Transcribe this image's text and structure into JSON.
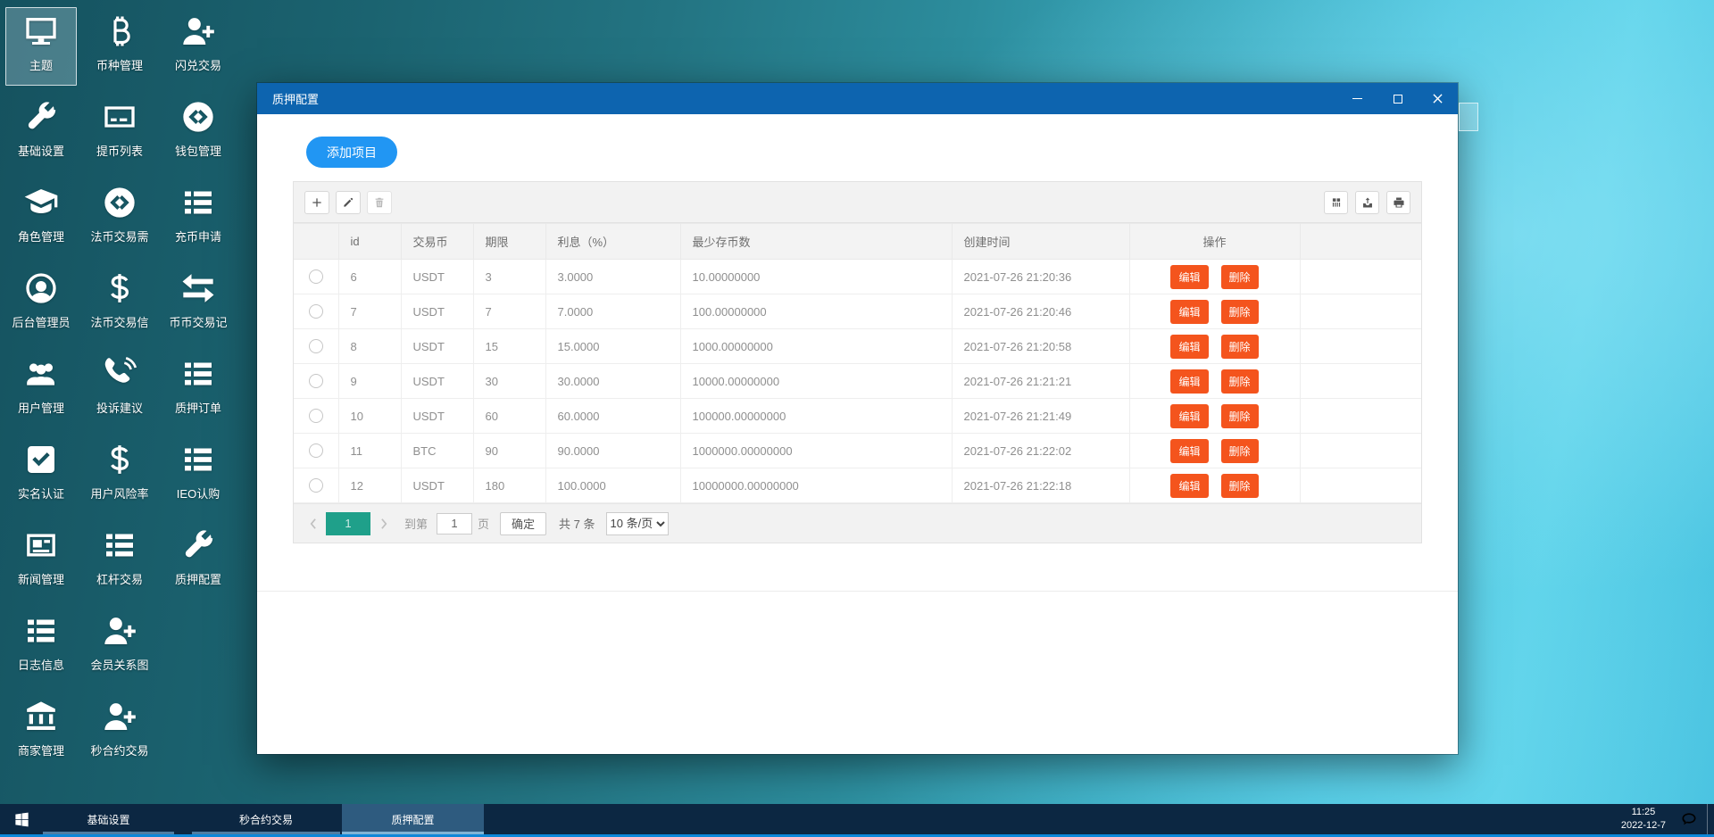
{
  "desktop": {
    "columns": [
      {
        "items": [
          {
            "icon": "monitor-icon",
            "label": "主题",
            "selected": true
          },
          {
            "icon": "wrench-icon",
            "label": "基础设置"
          },
          {
            "icon": "grad-cap-icon",
            "label": "角色管理"
          },
          {
            "icon": "user-circle-icon",
            "label": "后台管理员"
          },
          {
            "icon": "users-icon",
            "label": "用户管理"
          },
          {
            "icon": "check-square-icon",
            "label": "实名认证"
          },
          {
            "icon": "newspaper-icon",
            "label": "新闻管理"
          },
          {
            "icon": "list-icon",
            "label": "日志信息"
          },
          {
            "icon": "bank-icon",
            "label": "商家管理"
          }
        ]
      },
      {
        "items": [
          {
            "icon": "bitcoin-icon",
            "label": "币种管理"
          },
          {
            "icon": "card-icon",
            "label": "提币列表"
          },
          {
            "icon": "coin-circle-icon",
            "label": "法币交易需"
          },
          {
            "icon": "dollar-icon",
            "label": "法币交易信"
          },
          {
            "icon": "phone-icon",
            "label": "投诉建议"
          },
          {
            "icon": "dollar-icon",
            "label": "用户风险率"
          },
          {
            "icon": "list-icon",
            "label": "杠杆交易"
          },
          {
            "icon": "user-plus-icon",
            "label": "会员关系图"
          },
          {
            "icon": "user-plus-icon",
            "label": "秒合约交易"
          }
        ]
      },
      {
        "items": [
          {
            "icon": "user-plus-icon",
            "label": "闪兑交易"
          },
          {
            "icon": "coin-circle-icon",
            "label": "钱包管理"
          },
          {
            "icon": "list-icon",
            "label": "充币申请"
          },
          {
            "icon": "swap-icon",
            "label": "币币交易记"
          },
          {
            "icon": "list-icon",
            "label": "质押订单"
          },
          {
            "icon": "list-icon",
            "label": "IEO认购"
          },
          {
            "icon": "wrench-icon",
            "label": "质押配置"
          }
        ]
      }
    ]
  },
  "window": {
    "title": "质押配置",
    "add_button_label": "添加项目",
    "toolbar": {
      "left_icons": [
        {
          "icon": "plus-icon"
        },
        {
          "icon": "pencil-icon"
        },
        {
          "icon": "trash-icon",
          "disabled": true
        }
      ],
      "right_icons": [
        {
          "icon": "columns-icon"
        },
        {
          "icon": "export-icon"
        },
        {
          "icon": "printer-icon"
        }
      ]
    },
    "table": {
      "headers": [
        "id",
        "交易币",
        "期限",
        "利息（%）",
        "最少存币数",
        "创建时间",
        "操作"
      ],
      "rows": [
        {
          "id": "6",
          "coin": "USDT",
          "period": "3",
          "interest": "3.0000",
          "min_deposit": "10.00000000",
          "created": "2021-07-26 21:20:36"
        },
        {
          "id": "7",
          "coin": "USDT",
          "period": "7",
          "interest": "7.0000",
          "min_deposit": "100.00000000",
          "created": "2021-07-26 21:20:46"
        },
        {
          "id": "8",
          "coin": "USDT",
          "period": "15",
          "interest": "15.0000",
          "min_deposit": "1000.00000000",
          "created": "2021-07-26 21:20:58"
        },
        {
          "id": "9",
          "coin": "USDT",
          "period": "30",
          "interest": "30.0000",
          "min_deposit": "10000.00000000",
          "created": "2021-07-26 21:21:21"
        },
        {
          "id": "10",
          "coin": "USDT",
          "period": "60",
          "interest": "60.0000",
          "min_deposit": "100000.00000000",
          "created": "2021-07-26 21:21:49"
        },
        {
          "id": "11",
          "coin": "BTC",
          "period": "90",
          "interest": "90.0000",
          "min_deposit": "1000000.00000000",
          "created": "2021-07-26 21:22:02"
        },
        {
          "id": "12",
          "coin": "USDT",
          "period": "180",
          "interest": "100.0000",
          "min_deposit": "10000000.00000000",
          "created": "2021-07-26 21:22:18"
        }
      ],
      "row_actions": {
        "edit": "编辑",
        "delete": "删除"
      }
    },
    "pagination": {
      "current_page": "1",
      "goto_label": "到第",
      "page_input": "1",
      "page_unit": "页",
      "confirm_label": "确定",
      "total_label": "共 7 条",
      "page_size": "10 条/页"
    }
  },
  "taskbar": {
    "items": [
      {
        "label": "基础设置",
        "active": false
      },
      {
        "label": "秒合约交易",
        "active": false
      },
      {
        "label": "质押配置",
        "active": true
      }
    ],
    "clock": {
      "time": "11:25",
      "date": "2022-12-7"
    }
  },
  "colors": {
    "titlebar": "#0d64af",
    "accent_button": "#2196f3",
    "action_button": "#f4541d",
    "active_page": "#1fa08a",
    "taskbar": "#0c2742"
  }
}
